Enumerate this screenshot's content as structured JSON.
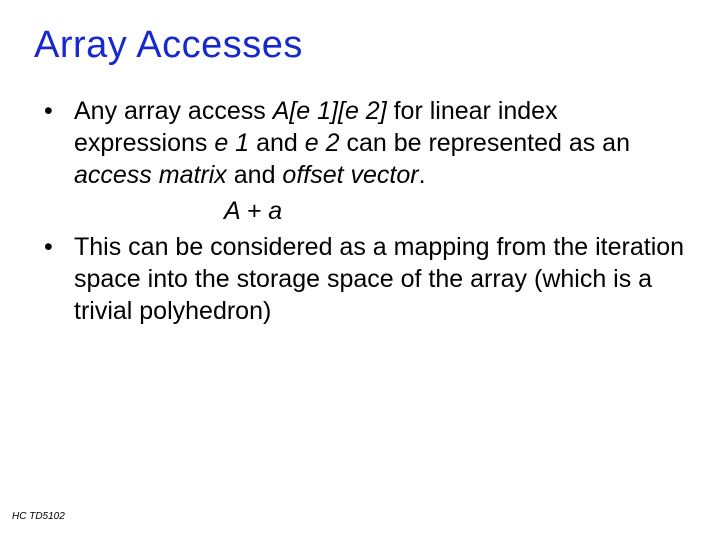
{
  "title": "Array Accesses",
  "bullet1": {
    "prefix": "Any array access ",
    "expr": "A[e 1][e 2]",
    "mid1": " for linear index expressions ",
    "e1": "e 1",
    "and": " and ",
    "e2": "e 2",
    "mid2": " can be represented as an ",
    "am": "access matrix",
    "and2": " and ",
    "ov": "offset vector",
    "period": "."
  },
  "formula": "A + a",
  "bullet2": "This can be considered as a mapping from the iteration space into the storage space of the array (which is a trivial polyhedron)",
  "footer": "HC  TD5102"
}
